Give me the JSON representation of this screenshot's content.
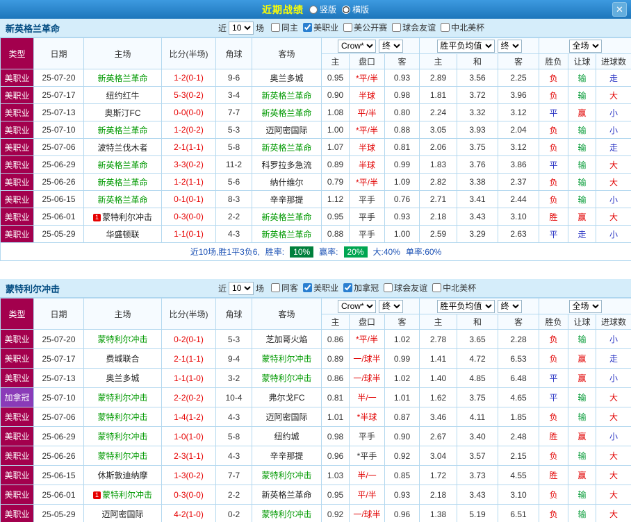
{
  "titlebar": {
    "title": "近期战绩",
    "layout": {
      "vertical_label": "竖版",
      "horizontal_label": "横版",
      "selected": "horizontal"
    },
    "close_label": "✕"
  },
  "columns": {
    "type": "类型",
    "date": "日期",
    "home": "主场",
    "score": "比分(半场)",
    "corner": "角球",
    "away": "客场",
    "asian_home": "主",
    "asian_handicap": "盘口",
    "asian_away": "客",
    "eu_home": "主",
    "eu_draw": "和",
    "eu_away": "客",
    "result": "胜负",
    "handicap_result": "让球",
    "goals": "进球数"
  },
  "controls": {
    "recent_prefix": "近",
    "recent_suffix": "场",
    "bookmaker": "Crow*",
    "final_a": "终",
    "avg_label": "胜平负均值",
    "final_b": "终",
    "scope": "全场"
  },
  "league_colors": {
    "美职业": "#a3004d",
    "加拿冠": "#8a3bb8"
  },
  "verdict_colors": {
    "red": "#e10000",
    "green": "#009933",
    "blue": "#2b35c4",
    "black": "#333333"
  },
  "sections": [
    {
      "team": "新英格兰革命",
      "recent_count": "10",
      "filters": [
        {
          "label": "同主",
          "checked": false
        },
        {
          "label": "美职业",
          "checked": true
        },
        {
          "label": "美公开赛",
          "checked": false
        },
        {
          "label": "球会友谊",
          "checked": false
        },
        {
          "label": "中北美杯",
          "checked": false
        }
      ],
      "rows": [
        {
          "league": "美职业",
          "date": "25-07-20",
          "home": "新英格兰革命",
          "home_self": true,
          "home_flag": false,
          "score": "1-2(0-1)",
          "corners": "9-6",
          "away": "奥兰多城",
          "away_self": false,
          "away_flag": false,
          "asian": [
            "0.95",
            "*平/半",
            "0.93"
          ],
          "asian_color": "red",
          "europe": [
            "2.89",
            "3.56",
            "2.25"
          ],
          "result": [
            "负",
            "red"
          ],
          "handicap_verdict": [
            "输",
            "green"
          ],
          "goals_verdict": [
            "走",
            "blue"
          ]
        },
        {
          "league": "美职业",
          "date": "25-07-17",
          "home": "纽约红牛",
          "home_self": false,
          "home_flag": false,
          "score": "5-3(0-2)",
          "corners": "3-4",
          "away": "新英格兰革命",
          "away_self": true,
          "away_flag": false,
          "asian": [
            "0.90",
            "半球",
            "0.98"
          ],
          "asian_color": "red",
          "europe": [
            "1.81",
            "3.72",
            "3.96"
          ],
          "result": [
            "负",
            "red"
          ],
          "handicap_verdict": [
            "输",
            "green"
          ],
          "goals_verdict": [
            "大",
            "red"
          ]
        },
        {
          "league": "美职业",
          "date": "25-07-13",
          "home": "奥斯汀FC",
          "home_self": false,
          "home_flag": false,
          "score": "0-0(0-0)",
          "corners": "7-7",
          "away": "新英格兰革命",
          "away_self": true,
          "away_flag": false,
          "asian": [
            "1.08",
            "平/半",
            "0.80"
          ],
          "asian_color": "red",
          "europe": [
            "2.24",
            "3.32",
            "3.12"
          ],
          "result": [
            "平",
            "blue"
          ],
          "handicap_verdict": [
            "赢",
            "red"
          ],
          "goals_verdict": [
            "小",
            "blue"
          ]
        },
        {
          "league": "美职业",
          "date": "25-07-10",
          "home": "新英格兰革命",
          "home_self": true,
          "home_flag": false,
          "score": "1-2(0-2)",
          "corners": "5-3",
          "away": "迈阿密国际",
          "away_self": false,
          "away_flag": false,
          "asian": [
            "1.00",
            "*平/半",
            "0.88"
          ],
          "asian_color": "red",
          "europe": [
            "3.05",
            "3.93",
            "2.04"
          ],
          "result": [
            "负",
            "red"
          ],
          "handicap_verdict": [
            "输",
            "green"
          ],
          "goals_verdict": [
            "小",
            "blue"
          ]
        },
        {
          "league": "美职业",
          "date": "25-07-06",
          "home": "波特兰伐木者",
          "home_self": false,
          "home_flag": false,
          "score": "2-1(1-1)",
          "corners": "5-8",
          "away": "新英格兰革命",
          "away_self": true,
          "away_flag": false,
          "asian": [
            "1.07",
            "半球",
            "0.81"
          ],
          "asian_color": "red",
          "europe": [
            "2.06",
            "3.75",
            "3.12"
          ],
          "result": [
            "负",
            "red"
          ],
          "handicap_verdict": [
            "输",
            "green"
          ],
          "goals_verdict": [
            "走",
            "blue"
          ]
        },
        {
          "league": "美职业",
          "date": "25-06-29",
          "home": "新英格兰革命",
          "home_self": true,
          "home_flag": false,
          "score": "3-3(0-2)",
          "corners": "11-2",
          "away": "科罗拉多急流",
          "away_self": false,
          "away_flag": false,
          "asian": [
            "0.89",
            "半球",
            "0.99"
          ],
          "asian_color": "red",
          "europe": [
            "1.83",
            "3.76",
            "3.86"
          ],
          "result": [
            "平",
            "blue"
          ],
          "handicap_verdict": [
            "输",
            "green"
          ],
          "goals_verdict": [
            "大",
            "red"
          ]
        },
        {
          "league": "美职业",
          "date": "25-06-26",
          "home": "新英格兰革命",
          "home_self": true,
          "home_flag": false,
          "score": "1-2(1-1)",
          "corners": "5-6",
          "away": "纳什维尔",
          "away_self": false,
          "away_flag": false,
          "asian": [
            "0.79",
            "*平/半",
            "1.09"
          ],
          "asian_color": "red",
          "europe": [
            "2.82",
            "3.38",
            "2.37"
          ],
          "result": [
            "负",
            "red"
          ],
          "handicap_verdict": [
            "输",
            "green"
          ],
          "goals_verdict": [
            "大",
            "red"
          ]
        },
        {
          "league": "美职业",
          "date": "25-06-15",
          "home": "新英格兰革命",
          "home_self": true,
          "home_flag": false,
          "score": "0-1(0-1)",
          "corners": "8-3",
          "away": "辛辛那提",
          "away_self": false,
          "away_flag": false,
          "asian": [
            "1.12",
            "平手",
            "0.76"
          ],
          "asian_color": "black",
          "europe": [
            "2.71",
            "3.41",
            "2.44"
          ],
          "result": [
            "负",
            "red"
          ],
          "handicap_verdict": [
            "输",
            "green"
          ],
          "goals_verdict": [
            "小",
            "blue"
          ]
        },
        {
          "league": "美职业",
          "date": "25-06-01",
          "home": "蒙特利尔冲击",
          "home_self": false,
          "home_flag": true,
          "score": "0-3(0-0)",
          "corners": "2-2",
          "away": "新英格兰革命",
          "away_self": true,
          "away_flag": false,
          "asian": [
            "0.95",
            "平手",
            "0.93"
          ],
          "asian_color": "black",
          "europe": [
            "2.18",
            "3.43",
            "3.10"
          ],
          "result": [
            "胜",
            "red"
          ],
          "handicap_verdict": [
            "赢",
            "red"
          ],
          "goals_verdict": [
            "大",
            "red"
          ]
        },
        {
          "league": "美职业",
          "date": "25-05-29",
          "home": "华盛顿联",
          "home_self": false,
          "home_flag": false,
          "score": "1-1(0-1)",
          "corners": "4-3",
          "away": "新英格兰革命",
          "away_self": true,
          "away_flag": false,
          "asian": [
            "0.88",
            "平手",
            "1.00"
          ],
          "asian_color": "black",
          "europe": [
            "2.59",
            "3.29",
            "2.63"
          ],
          "result": [
            "平",
            "blue"
          ],
          "handicap_verdict": [
            "走",
            "blue"
          ],
          "goals_verdict": [
            "小",
            "blue"
          ]
        }
      ],
      "summary": [
        {
          "text": "近10场,胜1平3负6,",
          "style": "label"
        },
        {
          "text": "胜率:",
          "style": "label"
        },
        {
          "text": "10%",
          "style": "badge_dark"
        },
        {
          "text": "赢率:",
          "style": "label"
        },
        {
          "text": "20%",
          "style": "badge_light"
        },
        {
          "text": "大:40%",
          "style": "label"
        },
        {
          "text": "单率:60%",
          "style": "label"
        }
      ]
    },
    {
      "team": "蒙特利尔冲击",
      "recent_count": "10",
      "filters": [
        {
          "label": "同客",
          "checked": false
        },
        {
          "label": "美职业",
          "checked": true
        },
        {
          "label": "加拿冠",
          "checked": true
        },
        {
          "label": "球会友谊",
          "checked": false
        },
        {
          "label": "中北美杯",
          "checked": false
        }
      ],
      "rows": [
        {
          "league": "美职业",
          "date": "25-07-20",
          "home": "蒙特利尔冲击",
          "home_self": true,
          "home_flag": false,
          "score": "0-2(0-1)",
          "corners": "5-3",
          "away": "芝加哥火焰",
          "away_self": false,
          "away_flag": false,
          "asian": [
            "0.86",
            "*平/半",
            "1.02"
          ],
          "asian_color": "red",
          "europe": [
            "2.78",
            "3.65",
            "2.28"
          ],
          "result": [
            "负",
            "red"
          ],
          "handicap_verdict": [
            "输",
            "green"
          ],
          "goals_verdict": [
            "小",
            "blue"
          ]
        },
        {
          "league": "美职业",
          "date": "25-07-17",
          "home": "费城联合",
          "home_self": false,
          "home_flag": false,
          "score": "2-1(1-1)",
          "corners": "9-4",
          "away": "蒙特利尔冲击",
          "away_self": true,
          "away_flag": false,
          "asian": [
            "0.89",
            "一/球半",
            "0.99"
          ],
          "asian_color": "red",
          "europe": [
            "1.41",
            "4.72",
            "6.53"
          ],
          "result": [
            "负",
            "red"
          ],
          "handicap_verdict": [
            "赢",
            "red"
          ],
          "goals_verdict": [
            "走",
            "blue"
          ]
        },
        {
          "league": "美职业",
          "date": "25-07-13",
          "home": "奥兰多城",
          "home_self": false,
          "home_flag": false,
          "score": "1-1(1-0)",
          "corners": "3-2",
          "away": "蒙特利尔冲击",
          "away_self": true,
          "away_flag": false,
          "asian": [
            "0.86",
            "一/球半",
            "1.02"
          ],
          "asian_color": "red",
          "europe": [
            "1.40",
            "4.85",
            "6.48"
          ],
          "result": [
            "平",
            "blue"
          ],
          "handicap_verdict": [
            "赢",
            "red"
          ],
          "goals_verdict": [
            "小",
            "blue"
          ]
        },
        {
          "league": "加拿冠",
          "date": "25-07-10",
          "home": "蒙特利尔冲击",
          "home_self": true,
          "home_flag": false,
          "score": "2-2(0-2)",
          "corners": "10-4",
          "away": "弗尔戈FC",
          "away_self": false,
          "away_flag": false,
          "asian": [
            "0.81",
            "半/一",
            "1.01"
          ],
          "asian_color": "red",
          "europe": [
            "1.62",
            "3.75",
            "4.65"
          ],
          "result": [
            "平",
            "blue"
          ],
          "handicap_verdict": [
            "输",
            "green"
          ],
          "goals_verdict": [
            "大",
            "red"
          ]
        },
        {
          "league": "美职业",
          "date": "25-07-06",
          "home": "蒙特利尔冲击",
          "home_self": true,
          "home_flag": false,
          "score": "1-4(1-2)",
          "corners": "4-3",
          "away": "迈阿密国际",
          "away_self": false,
          "away_flag": false,
          "asian": [
            "1.01",
            "*半球",
            "0.87"
          ],
          "asian_color": "red",
          "europe": [
            "3.46",
            "4.11",
            "1.85"
          ],
          "result": [
            "负",
            "red"
          ],
          "handicap_verdict": [
            "输",
            "green"
          ],
          "goals_verdict": [
            "大",
            "red"
          ]
        },
        {
          "league": "美职业",
          "date": "25-06-29",
          "home": "蒙特利尔冲击",
          "home_self": true,
          "home_flag": false,
          "score": "1-0(1-0)",
          "corners": "5-8",
          "away": "纽约城",
          "away_self": false,
          "away_flag": false,
          "asian": [
            "0.98",
            "平手",
            "0.90"
          ],
          "asian_color": "black",
          "europe": [
            "2.67",
            "3.40",
            "2.48"
          ],
          "result": [
            "胜",
            "red"
          ],
          "handicap_verdict": [
            "赢",
            "red"
          ],
          "goals_verdict": [
            "小",
            "blue"
          ]
        },
        {
          "league": "美职业",
          "date": "25-06-26",
          "home": "蒙特利尔冲击",
          "home_self": true,
          "home_flag": false,
          "score": "2-3(1-1)",
          "corners": "4-3",
          "away": "辛辛那提",
          "away_self": false,
          "away_flag": false,
          "asian": [
            "0.96",
            "*平手",
            "0.92"
          ],
          "asian_color": "black",
          "europe": [
            "3.04",
            "3.57",
            "2.15"
          ],
          "result": [
            "负",
            "red"
          ],
          "handicap_verdict": [
            "输",
            "green"
          ],
          "goals_verdict": [
            "大",
            "red"
          ]
        },
        {
          "league": "美职业",
          "date": "25-06-15",
          "home": "休斯敦迪纳摩",
          "home_self": false,
          "home_flag": false,
          "score": "1-3(0-2)",
          "corners": "7-7",
          "away": "蒙特利尔冲击",
          "away_self": true,
          "away_flag": false,
          "asian": [
            "1.03",
            "半/一",
            "0.85"
          ],
          "asian_color": "red",
          "europe": [
            "1.72",
            "3.73",
            "4.55"
          ],
          "result": [
            "胜",
            "red"
          ],
          "handicap_verdict": [
            "赢",
            "red"
          ],
          "goals_verdict": [
            "大",
            "red"
          ]
        },
        {
          "league": "美职业",
          "date": "25-06-01",
          "home": "蒙特利尔冲击",
          "home_self": true,
          "home_flag": true,
          "score": "0-3(0-0)",
          "corners": "2-2",
          "away": "新英格兰革命",
          "away_self": false,
          "away_flag": false,
          "asian": [
            "0.95",
            "平/半",
            "0.93"
          ],
          "asian_color": "red",
          "europe": [
            "2.18",
            "3.43",
            "3.10"
          ],
          "result": [
            "负",
            "red"
          ],
          "handicap_verdict": [
            "输",
            "green"
          ],
          "goals_verdict": [
            "大",
            "red"
          ]
        },
        {
          "league": "美职业",
          "date": "25-05-29",
          "home": "迈阿密国际",
          "home_self": false,
          "home_flag": false,
          "score": "4-2(1-0)",
          "corners": "0-2",
          "away": "蒙特利尔冲击",
          "away_self": true,
          "away_flag": false,
          "asian": [
            "0.92",
            "一/球半",
            "0.96"
          ],
          "asian_color": "red",
          "europe": [
            "1.38",
            "5.19",
            "6.51"
          ],
          "result": [
            "负",
            "red"
          ],
          "handicap_verdict": [
            "输",
            "green"
          ],
          "goals_verdict": [
            "大",
            "red"
          ]
        }
      ],
      "summary": []
    }
  ]
}
